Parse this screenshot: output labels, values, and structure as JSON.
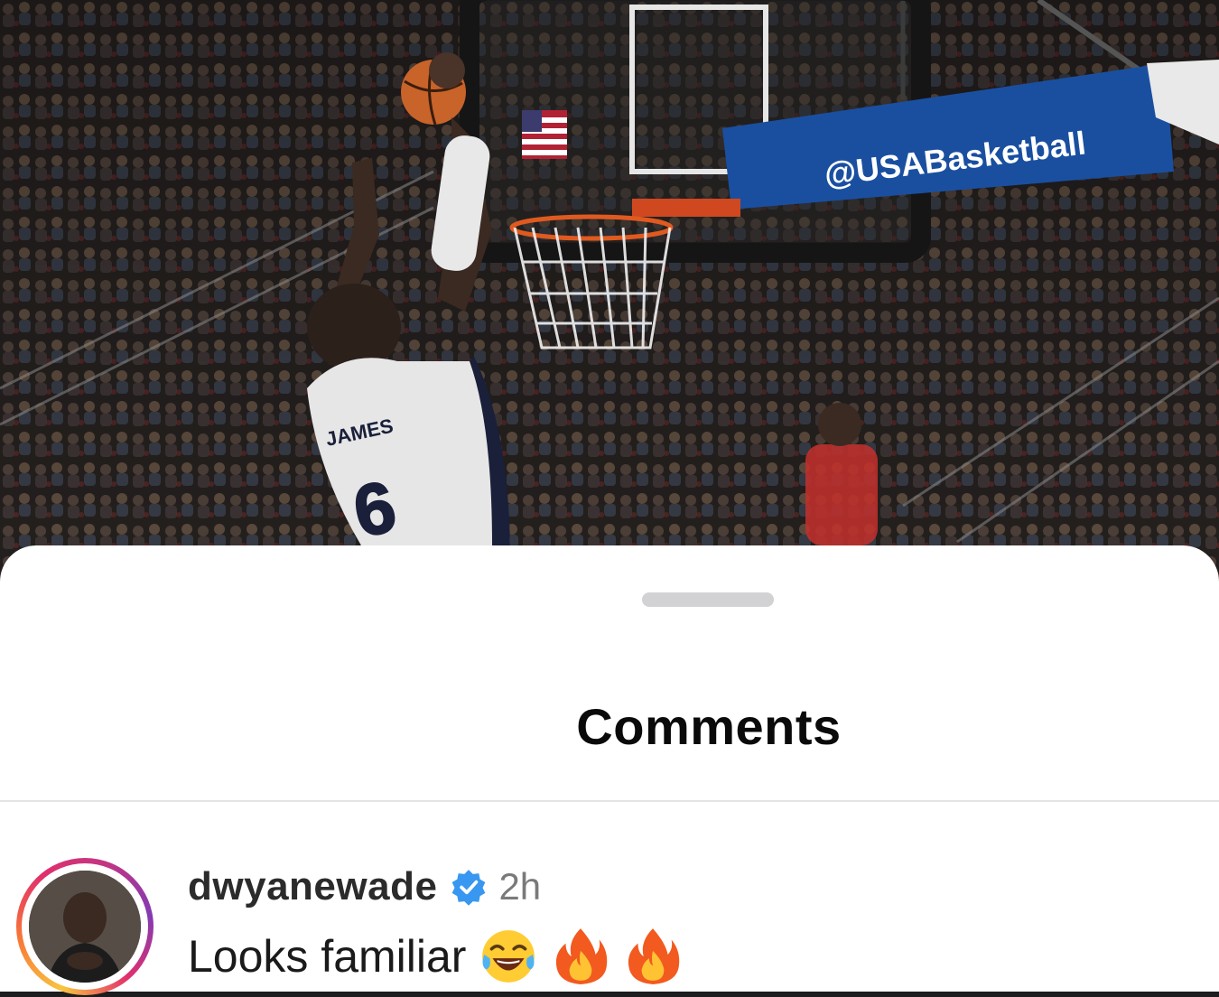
{
  "photo": {
    "banner_text": "@USABasketball",
    "jersey_name": "JAMES",
    "jersey_number": "6"
  },
  "sheet": {
    "title": "Comments"
  },
  "comment": {
    "username": "dwyanewade",
    "verified": true,
    "time": "2h",
    "text": "Looks familiar",
    "emojis": [
      "face-with-tears-of-joy",
      "fire",
      "fire"
    ]
  },
  "colors": {
    "sheet_background": "#ffffff",
    "verified_badge": "#3897f0",
    "story_ring": [
      "#f9c440",
      "#f77737",
      "#e1306c",
      "#833ab4"
    ]
  }
}
